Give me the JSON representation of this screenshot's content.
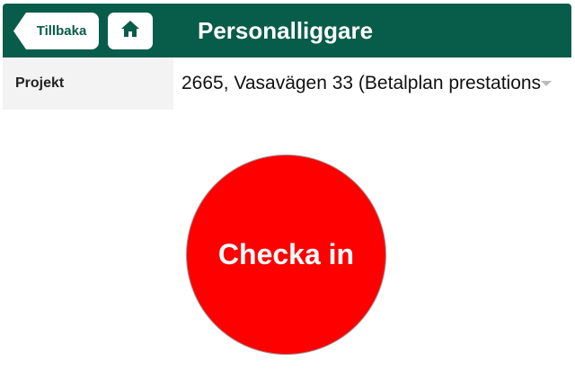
{
  "header": {
    "back_label": "Tillbaka",
    "home_icon": "home-icon",
    "title": "Personalliggare"
  },
  "project": {
    "label": "Projekt",
    "selected_value": "2665, Vasavägen 33 (Betalplan prestations"
  },
  "checkin": {
    "label": "Checka in"
  },
  "colors": {
    "header_bg": "#085c4a",
    "checkin_bg": "#ff0000",
    "label_bg": "#f3f3f3"
  }
}
